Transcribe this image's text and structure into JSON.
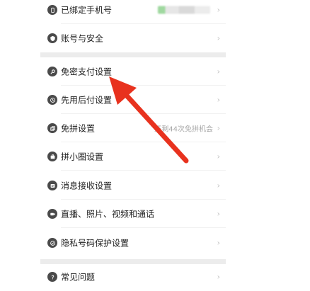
{
  "settings": {
    "items": [
      {
        "label": "已绑定手机号",
        "value": "",
        "icon": "phone-icon"
      },
      {
        "label": "账号与安全",
        "value": "",
        "icon": "shield-icon"
      },
      {
        "label": "免密支付设置",
        "value": "",
        "icon": "key-icon"
      },
      {
        "label": "先用后付设置",
        "value": "",
        "icon": "clock-icon"
      },
      {
        "label": "免拼设置",
        "value": "还剩44次免拼机会",
        "icon": "copy-icon"
      },
      {
        "label": "拼小圈设置",
        "value": "",
        "icon": "briefcase-icon"
      },
      {
        "label": "消息接收设置",
        "value": "",
        "icon": "message-icon"
      },
      {
        "label": "直播、照片、视频和通话",
        "value": "",
        "icon": "camera-icon"
      },
      {
        "label": "隐私号码保护设置",
        "value": "",
        "icon": "privacy-shield-icon"
      },
      {
        "label": "常见问题",
        "value": "",
        "icon": "question-icon"
      }
    ],
    "chevron": "›"
  },
  "annotation": {
    "color": "#e8321e",
    "icon": "red-arrow-pointing-to-item"
  }
}
